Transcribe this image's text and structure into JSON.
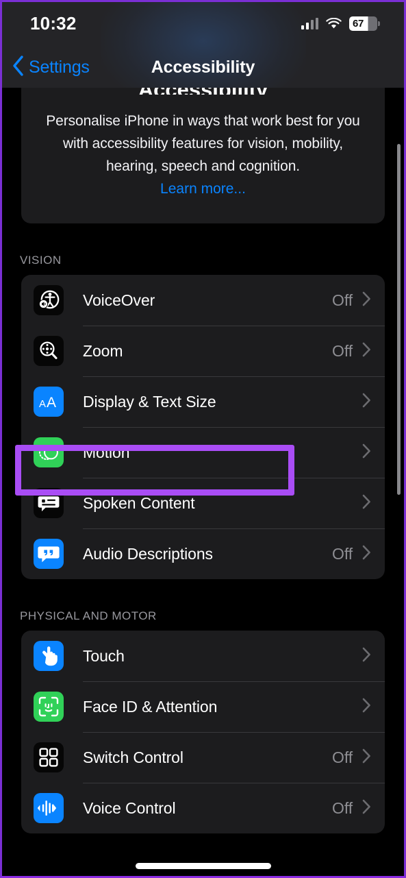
{
  "status_bar": {
    "time": "10:32",
    "battery_percent": "67",
    "cellular_icon": "cellular-bars-icon",
    "wifi_icon": "wifi-icon",
    "battery_icon": "battery-icon"
  },
  "nav": {
    "back_label": "Settings",
    "back_icon": "chevron-left-icon",
    "title": "Accessibility"
  },
  "large_title": "Accessibility",
  "intro": {
    "text": "Personalise iPhone in ways that work best for you with accessibility features for vision, mobility, hearing, speech and cognition.",
    "link": "Learn more..."
  },
  "highlight": {
    "color": "#A94DF5",
    "target": "Motion"
  },
  "sections": [
    {
      "header": "VISION",
      "rows": [
        {
          "label": "VoiceOver",
          "value": "Off",
          "icon": "voiceover-icon",
          "icon_style": "icon-black"
        },
        {
          "label": "Zoom",
          "value": "Off",
          "icon": "zoom-magnifier-icon",
          "icon_style": "icon-black"
        },
        {
          "label": "Display & Text Size",
          "value": "",
          "icon": "display-text-size-icon",
          "icon_style": "icon-blue"
        },
        {
          "label": "Motion",
          "value": "",
          "icon": "motion-icon",
          "icon_style": "icon-green"
        },
        {
          "label": "Spoken Content",
          "value": "",
          "icon": "spoken-content-icon",
          "icon_style": "icon-black"
        },
        {
          "label": "Audio Descriptions",
          "value": "Off",
          "icon": "audio-descriptions-icon",
          "icon_style": "icon-blue"
        }
      ]
    },
    {
      "header": "PHYSICAL AND MOTOR",
      "rows": [
        {
          "label": "Touch",
          "value": "",
          "icon": "touch-hand-icon",
          "icon_style": "icon-blue"
        },
        {
          "label": "Face ID & Attention",
          "value": "",
          "icon": "face-id-icon",
          "icon_style": "icon-green"
        },
        {
          "label": "Switch Control",
          "value": "Off",
          "icon": "switch-control-icon",
          "icon_style": "icon-black"
        },
        {
          "label": "Voice Control",
          "value": "Off",
          "icon": "voice-control-icon",
          "icon_style": "icon-blue"
        }
      ]
    }
  ],
  "colors": {
    "accent_blue": "#0A84FF",
    "highlight_purple": "#A94DF5",
    "card_background": "#1C1C1E",
    "page_background": "#000000",
    "secondary_text": "#8E8E93"
  }
}
